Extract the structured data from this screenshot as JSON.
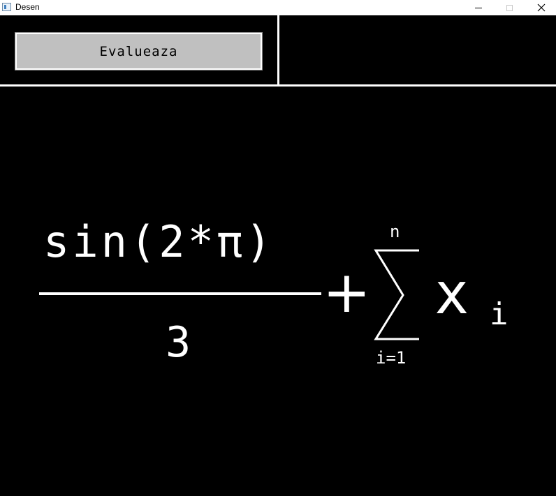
{
  "window": {
    "title": "Desen",
    "icon": "window-app-icon",
    "controls": {
      "minimize": "minimize-icon",
      "maximize": "maximize-icon",
      "close": "close-icon",
      "close_glyph": "✕"
    }
  },
  "toolbar": {
    "evaluate_label": "Evalueaza"
  },
  "formula": {
    "numerator": "sin(2*π)",
    "denominator": "3",
    "operator": "+",
    "sum_upper": "n",
    "sum_lower": "i=1",
    "variable": "x",
    "subscript": "i"
  },
  "colors": {
    "canvas": "#000000",
    "ink": "#ffffff",
    "button": "#c0c0c0"
  }
}
